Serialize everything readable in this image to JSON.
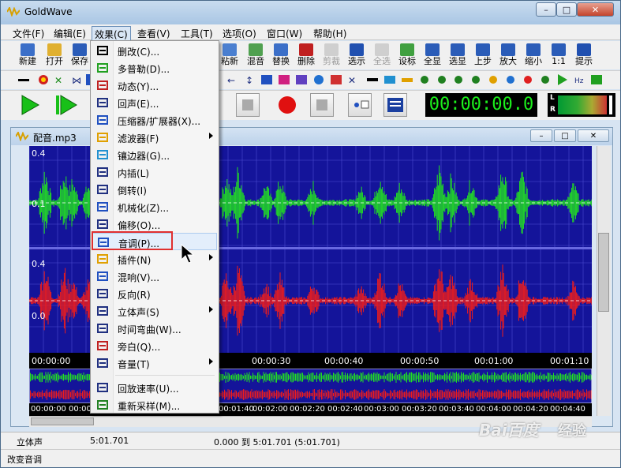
{
  "window": {
    "title": "GoldWave",
    "min_glyph": "–",
    "max_glyph": "□",
    "close_glyph": "✕"
  },
  "menubar": [
    "文件(F)",
    "编辑(E)",
    "效果(C)",
    "查看(V)",
    "工具(T)",
    "选项(O)",
    "窗口(W)",
    "帮助(H)"
  ],
  "toolbar1": [
    {
      "label": "新建",
      "icon": "new-file-icon"
    },
    {
      "label": "打开",
      "icon": "open-folder-icon"
    },
    {
      "label": "保存",
      "icon": "save-icon"
    },
    {
      "label": "粘新",
      "icon": "paste-new-icon"
    },
    {
      "label": "混音",
      "icon": "mix-icon"
    },
    {
      "label": "替换",
      "icon": "replace-icon"
    },
    {
      "label": "删除",
      "icon": "delete-icon"
    },
    {
      "label": "剪裁",
      "icon": "trim-icon",
      "disabled": true
    },
    {
      "label": "选示",
      "icon": "select-view-icon"
    },
    {
      "label": "全选",
      "icon": "select-all-icon",
      "disabled": true
    },
    {
      "label": "设标",
      "icon": "set-marker-icon"
    },
    {
      "label": "全显",
      "icon": "zoom-all-icon"
    },
    {
      "label": "选显",
      "icon": "zoom-selection-icon"
    },
    {
      "label": "上步",
      "icon": "zoom-previous-icon"
    },
    {
      "label": "放大",
      "icon": "zoom-in-icon"
    },
    {
      "label": "缩小",
      "icon": "zoom-out-icon"
    },
    {
      "label": "1:1",
      "icon": "zoom-1to1-icon"
    },
    {
      "label": "提示",
      "icon": "cue-icon"
    }
  ],
  "transport": {
    "time": "00:00:00.0",
    "meter_left": "L",
    "meter_right": "R"
  },
  "child": {
    "title": "配音.mp3"
  },
  "axis_labels": {
    "top_ch": "0.4",
    "mid_ch": "0.1",
    "bottom_ch": "0.0",
    "lower_ch": "0.4"
  },
  "timeline": [
    "00:00:00",
    "00:00:30",
    "00:00:40",
    "00:00:50",
    "00:01:00",
    "00:01:10"
  ],
  "overview_timeline": [
    "00:00:00",
    "00:00:2",
    "00:01:40",
    "00:02:00",
    "00:02:20",
    "00:02:40",
    "00:03:00",
    "00:03:20",
    "00:03:40",
    "00:04:00",
    "00:04:20",
    "00:04:40",
    "00:05:00"
  ],
  "status": {
    "channel": "立体声",
    "length": "5:01.701",
    "range": "0.000 到 5:01.701 (5:01.701)",
    "hint": "改变音调"
  },
  "effects_menu": [
    {
      "label": "删改(C)...",
      "icon": "delete-change-icon"
    },
    {
      "label": "多普勒(D)...",
      "icon": "doppler-icon"
    },
    {
      "label": "动态(Y)...",
      "icon": "dynamics-icon"
    },
    {
      "label": "回声(E)...",
      "icon": "echo-icon"
    },
    {
      "label": "压缩器/扩展器(X)...",
      "icon": "compressor-icon"
    },
    {
      "label": "滤波器(F)",
      "icon": "filter-icon",
      "submenu": true
    },
    {
      "label": "镶边器(G)...",
      "icon": "flanger-icon"
    },
    {
      "label": "内插(L)",
      "icon": "interpolate-icon"
    },
    {
      "label": "倒转(I)",
      "icon": "invert-icon"
    },
    {
      "label": "机械化(Z)...",
      "icon": "mechanize-icon"
    },
    {
      "label": "偏移(O)...",
      "icon": "offset-icon"
    },
    {
      "label": "音调(P)...",
      "icon": "pitch-icon",
      "highlighted": true
    },
    {
      "label": "插件(N)",
      "icon": "plugin-icon",
      "submenu": true
    },
    {
      "label": "混响(V)...",
      "icon": "reverb-icon"
    },
    {
      "label": "反向(R)",
      "icon": "reverse-icon"
    },
    {
      "label": "立体声(S)",
      "icon": "stereo-icon",
      "submenu": true
    },
    {
      "label": "时间弯曲(W)...",
      "icon": "time-warp-icon"
    },
    {
      "label": "旁白(Q)...",
      "icon": "voiceover-icon"
    },
    {
      "label": "音量(T)",
      "icon": "volume-icon",
      "submenu": true
    },
    {
      "label": "回放速率(U)...",
      "icon": "playback-rate-icon"
    },
    {
      "label": "重新采样(M)...",
      "icon": "resample-icon"
    }
  ],
  "watermark": {
    "brand": "Bai百度",
    "sub": "经验"
  },
  "colors": {
    "wave_bg": "#14149a",
    "left_channel": "#22e022",
    "right_channel": "#ee1c1c",
    "highlight": "#e03030"
  }
}
